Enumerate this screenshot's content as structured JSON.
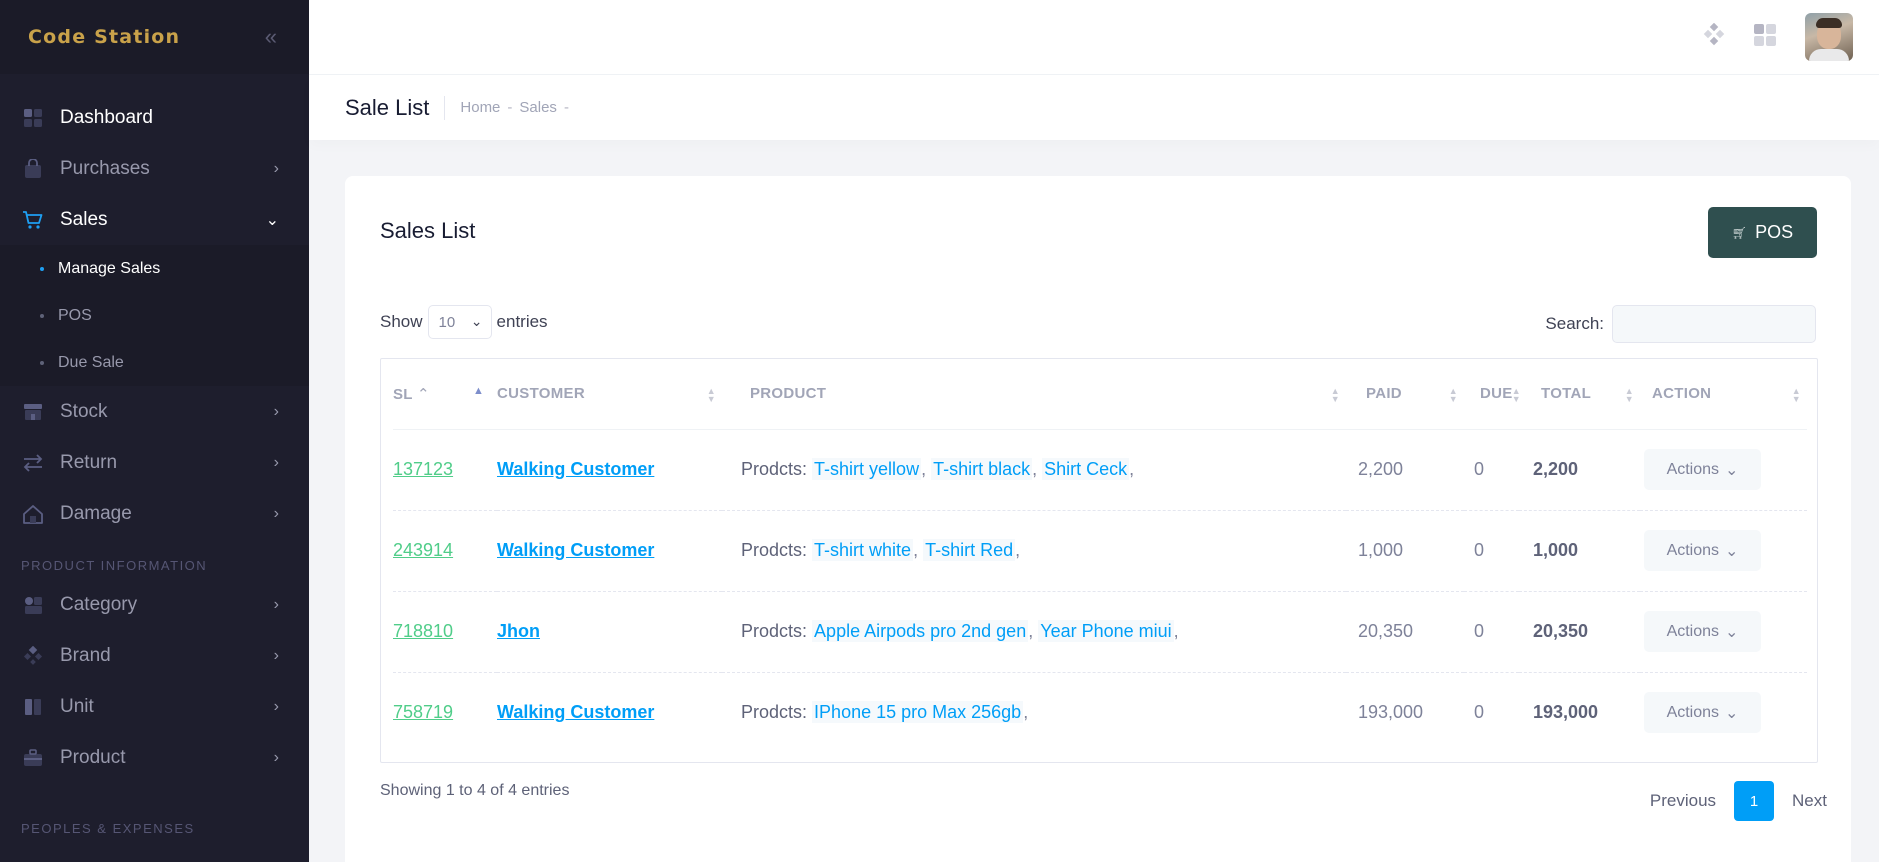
{
  "brand": {
    "logo_text": "Code Station"
  },
  "sidebar": {
    "items": [
      {
        "label": "Dashboard",
        "icon": "dashboard-icon"
      },
      {
        "label": "Purchases",
        "icon": "bag-icon"
      },
      {
        "label": "Sales",
        "icon": "cart-icon",
        "children": [
          "Manage Sales",
          "POS",
          "Due Sale"
        ]
      },
      {
        "label": "Stock",
        "icon": "store-icon"
      },
      {
        "label": "Return",
        "icon": "arrows-exchange-icon"
      },
      {
        "label": "Damage",
        "icon": "home-icon"
      }
    ],
    "section_product": "PRODUCT INFORMATION",
    "product_items": [
      {
        "label": "Category",
        "icon": "category-icon"
      },
      {
        "label": "Brand",
        "icon": "brand-icon"
      },
      {
        "label": "Unit",
        "icon": "unit-icon"
      },
      {
        "label": "Product",
        "icon": "briefcase-icon"
      }
    ],
    "section_peoples": "PEOPLES & EXPENSES"
  },
  "subheader": {
    "title": "Sale List",
    "breadcrumb": [
      "Home",
      "Sales"
    ]
  },
  "card": {
    "title": "Sales List",
    "pos_button": "POS",
    "show_label": "Show",
    "entries_value": "10",
    "entries_label": "entries",
    "search_label": "Search:",
    "search_value": ""
  },
  "table": {
    "headers": [
      "SL",
      "CUSTOMER",
      "PRODUCT",
      "PAID",
      "DUE",
      "TOTAL",
      "ACTION"
    ],
    "product_prefix": "Prodcts:",
    "actions_label": "Actions",
    "rows": [
      {
        "sl": "137123",
        "customer": "Walking Customer",
        "products": [
          "T-shirt yellow",
          "T-shirt black",
          "Shirt Ceck"
        ],
        "paid": "2,200",
        "due": "0",
        "total": "2,200"
      },
      {
        "sl": "243914",
        "customer": "Walking Customer",
        "products": [
          "T-shirt white",
          "T-shirt Red"
        ],
        "paid": "1,000",
        "due": "0",
        "total": "1,000"
      },
      {
        "sl": "718810",
        "customer": "Jhon",
        "products": [
          "Apple Airpods pro 2nd gen",
          "Year Phone miui"
        ],
        "paid": "20,350",
        "due": "0",
        "total": "20,350"
      },
      {
        "sl": "758719",
        "customer": "Walking Customer",
        "products": [
          "IPhone 15 pro Max 256gb"
        ],
        "paid": "193,000",
        "due": "0",
        "total": "193,000"
      }
    ]
  },
  "footer": {
    "info": "Showing 1 to 4 of 4 entries",
    "previous": "Previous",
    "current_page": "1",
    "next": "Next"
  },
  "colors": {
    "sidebar_bg": "#1e1e2d",
    "accent": "#009ef7",
    "success": "#50cd89",
    "pos_button": "#2f4f4f",
    "logo": "#c9a24a"
  }
}
